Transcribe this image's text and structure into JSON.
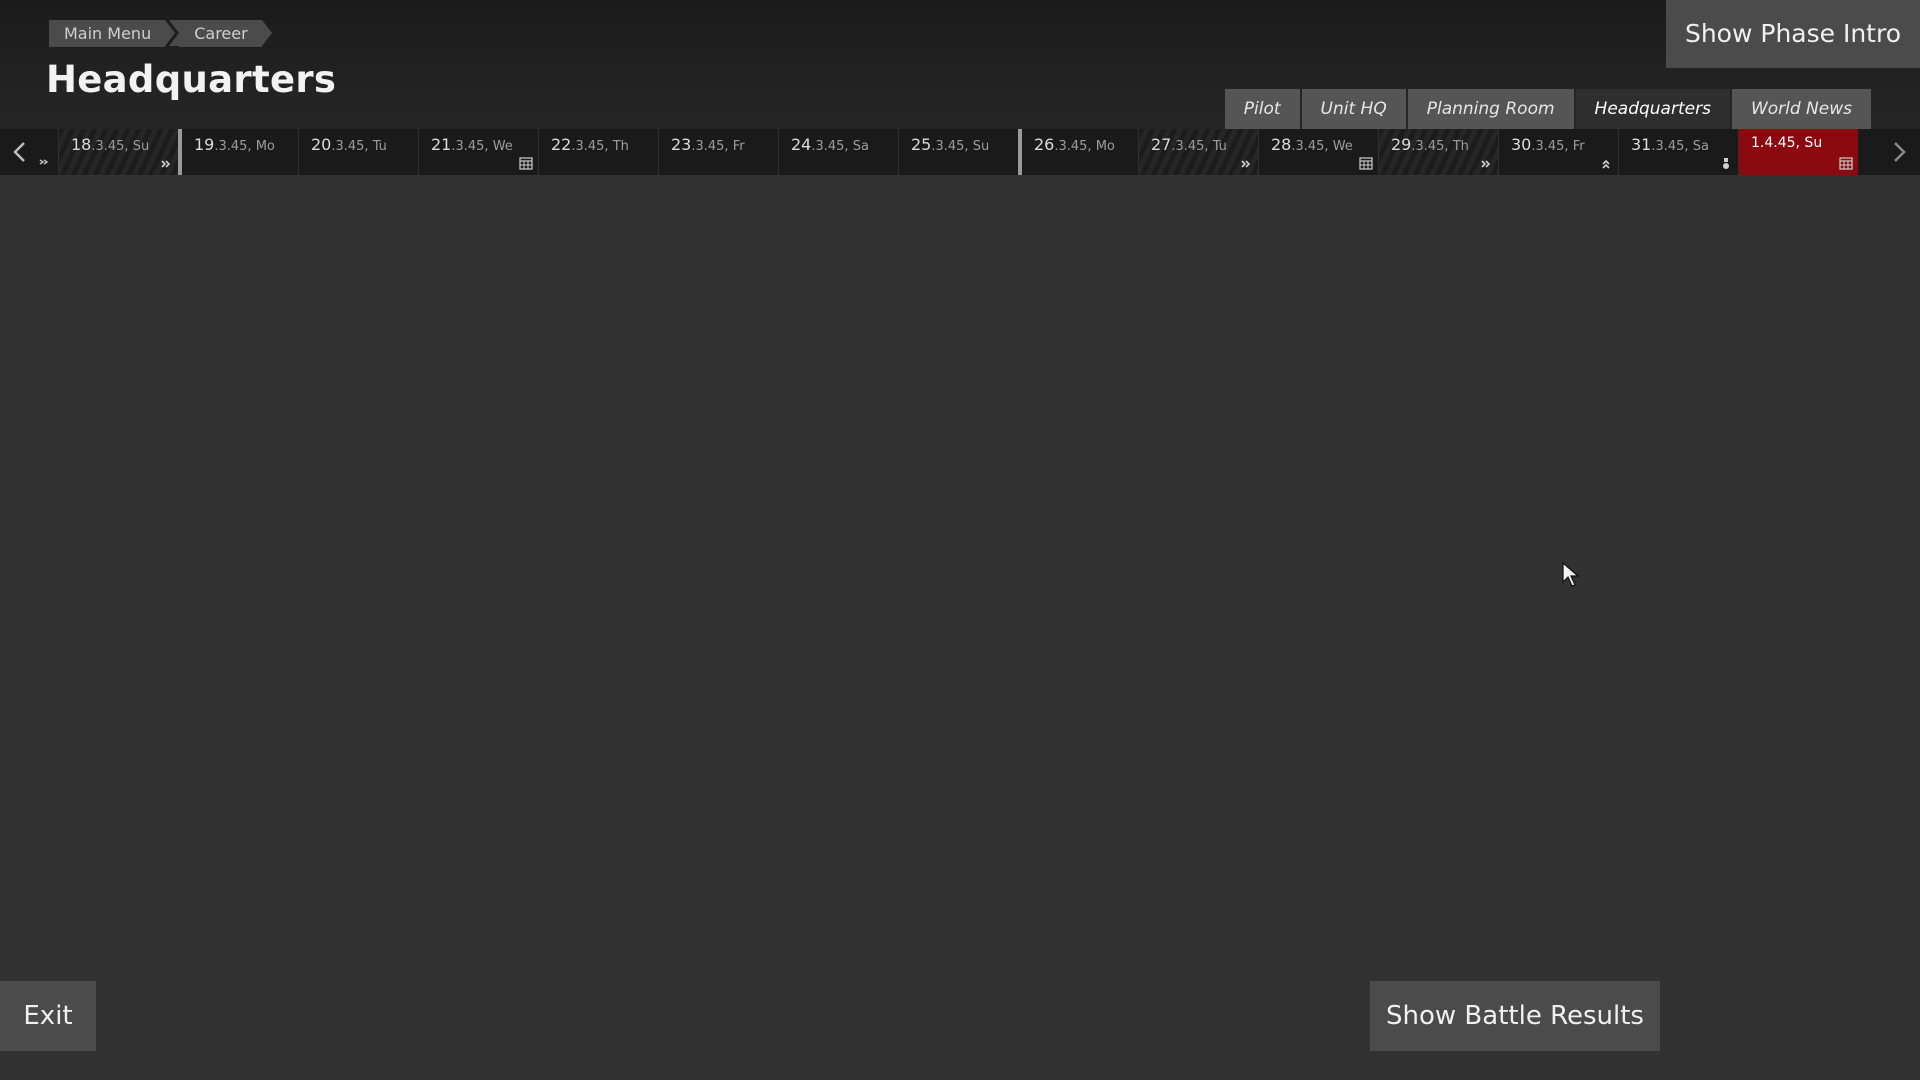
{
  "breadcrumb": [
    "Main Menu",
    "Career"
  ],
  "page_title": "Headquarters",
  "phase_intro_label": "Show Phase Intro",
  "tabs": [
    {
      "label": "Pilot",
      "active": false
    },
    {
      "label": "Unit HQ",
      "active": false
    },
    {
      "label": "Planning Room",
      "active": false
    },
    {
      "label": "Headquarters",
      "active": true
    },
    {
      "label": "World News",
      "active": false
    }
  ],
  "timeline": {
    "prev_icon": "chevron-left-icon",
    "next_icon": "chevron-right-icon",
    "days": [
      {
        "num": "18",
        "rest": ".3.45, Su",
        "marker": "fast-forward-icon"
      },
      {
        "num": "19",
        "rest": ".3.45, Mo",
        "marker": ""
      },
      {
        "num": "20",
        "rest": ".3.45, Tu",
        "marker": ""
      },
      {
        "num": "21",
        "rest": ".3.45, We",
        "marker": "calendar-icon"
      },
      {
        "num": "22",
        "rest": ".3.45, Th",
        "marker": ""
      },
      {
        "num": "23",
        "rest": ".3.45, Fr",
        "marker": ""
      },
      {
        "num": "24",
        "rest": ".3.45, Sa",
        "marker": ""
      },
      {
        "num": "25",
        "rest": ".3.45, Su",
        "marker": ""
      },
      {
        "num": "26",
        "rest": ".3.45, Mo",
        "marker": ""
      },
      {
        "num": "27",
        "rest": ".3.45, Tu",
        "marker": "fast-forward-icon"
      },
      {
        "num": "28",
        "rest": ".3.45, We",
        "marker": "calendar-icon"
      },
      {
        "num": "29",
        "rest": ".3.45, Th",
        "marker": "fast-forward-icon"
      },
      {
        "num": "30",
        "rest": ".3.45, Fr",
        "marker": "chevron-up-double-icon"
      },
      {
        "num": "31",
        "rest": ".3.45, Sa",
        "marker": "medal-icon"
      },
      {
        "num": "1.4.45, Su",
        "rest": "",
        "marker": "calendar-icon"
      }
    ]
  },
  "buttons": {
    "exit": "Exit",
    "battle_results": "Show Battle Results"
  },
  "colors": {
    "background": "#323232",
    "current_day": "#8a0a0f",
    "button": "#4b4b4b"
  }
}
